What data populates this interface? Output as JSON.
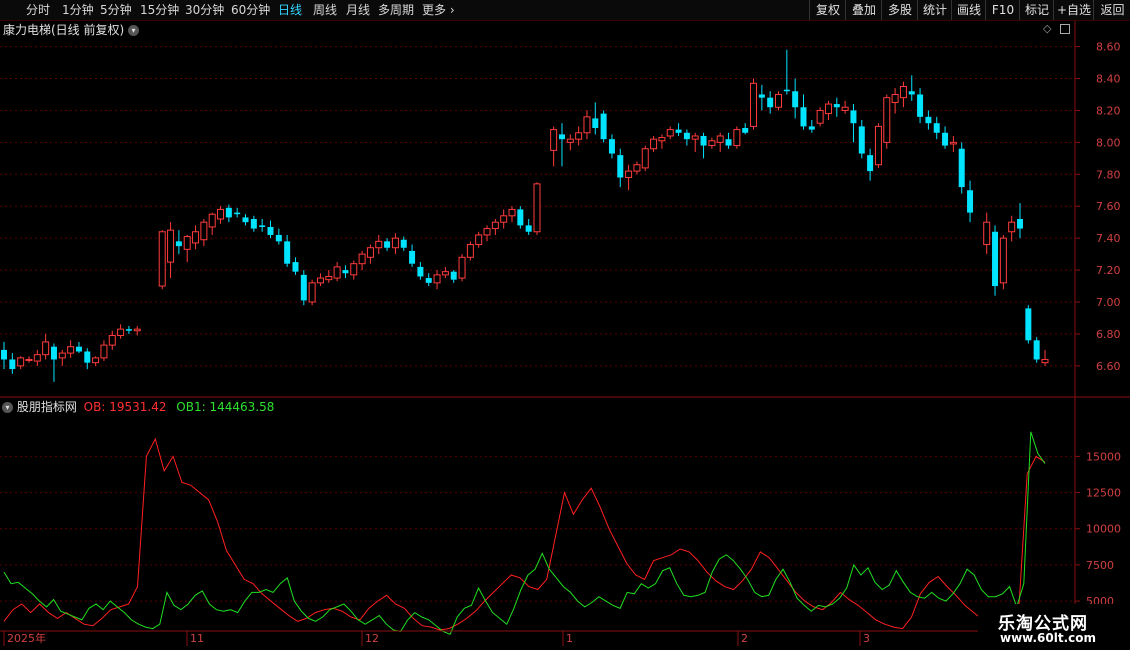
{
  "toolbar": {
    "periods": [
      "分时",
      "1分钟",
      "5分钟",
      "15分钟",
      "30分钟",
      "60分钟",
      "日线",
      "周线",
      "月线",
      "多周期",
      "更多"
    ],
    "active_period": "日线",
    "right_buttons": [
      "复权",
      "叠加",
      "多股",
      "统计",
      "画线",
      "F10",
      "标记",
      "+自选",
      "返回"
    ]
  },
  "chart": {
    "title": "康力电梯(日线 前复权)"
  },
  "indicator": {
    "name": "股朋指标网",
    "ob_label": "OB: 19531.42",
    "ob1_label": "OB1: 144463.58"
  },
  "colors": {
    "up": "#ff3c3c",
    "down": "#00e4ff",
    "ob": "#ff2020",
    "ob1": "#20e020",
    "grid": "#5a0000",
    "axis_text": "#d04040"
  },
  "watermark": {
    "line1": "乐淘公式网",
    "line2": "www.60lt.com"
  },
  "chart_data": [
    {
      "type": "candlestick",
      "title": "康力电梯(日线 前复权)",
      "y_ticks": [
        6.6,
        6.8,
        7.0,
        7.2,
        7.4,
        7.6,
        7.8,
        8.0,
        8.2,
        8.4,
        8.6
      ],
      "ylim": [
        6.43,
        8.66
      ],
      "ohlc": [
        [
          6.7,
          6.75,
          6.58,
          6.64
        ],
        [
          6.64,
          6.68,
          6.55,
          6.58
        ],
        [
          6.6,
          6.66,
          6.58,
          6.65
        ],
        [
          6.64,
          6.66,
          6.62,
          6.64
        ],
        [
          6.63,
          6.7,
          6.6,
          6.67
        ],
        [
          6.67,
          6.8,
          6.64,
          6.75
        ],
        [
          6.72,
          6.74,
          6.5,
          6.64
        ],
        [
          6.65,
          6.7,
          6.6,
          6.68
        ],
        [
          6.68,
          6.76,
          6.65,
          6.72
        ],
        [
          6.72,
          6.75,
          6.68,
          6.69
        ],
        [
          6.69,
          6.71,
          6.58,
          6.62
        ],
        [
          6.62,
          6.66,
          6.6,
          6.65
        ],
        [
          6.65,
          6.76,
          6.63,
          6.73
        ],
        [
          6.73,
          6.82,
          6.7,
          6.79
        ],
        [
          6.79,
          6.86,
          6.77,
          6.83
        ],
        [
          6.83,
          6.85,
          6.8,
          6.82
        ],
        [
          6.82,
          6.85,
          6.79,
          6.83
        ],
        [
          7.1,
          7.45,
          7.08,
          7.44
        ],
        [
          7.25,
          7.5,
          7.15,
          7.45
        ],
        [
          7.38,
          7.45,
          7.3,
          7.35
        ],
        [
          7.33,
          7.42,
          7.25,
          7.41
        ],
        [
          7.37,
          7.48,
          7.33,
          7.44
        ],
        [
          7.39,
          7.52,
          7.35,
          7.5
        ],
        [
          7.47,
          7.56,
          7.42,
          7.55
        ],
        [
          7.52,
          7.6,
          7.49,
          7.58
        ],
        [
          7.59,
          7.61,
          7.5,
          7.53
        ],
        [
          7.56,
          7.59,
          7.53,
          7.55
        ],
        [
          7.53,
          7.55,
          7.48,
          7.5
        ],
        [
          7.52,
          7.54,
          7.44,
          7.46
        ],
        [
          7.48,
          7.52,
          7.44,
          7.47
        ],
        [
          7.47,
          7.51,
          7.4,
          7.42
        ],
        [
          7.42,
          7.46,
          7.36,
          7.38
        ],
        [
          7.38,
          7.42,
          7.22,
          7.24
        ],
        [
          7.25,
          7.28,
          7.17,
          7.19
        ],
        [
          7.17,
          7.2,
          6.98,
          7.01
        ],
        [
          7.0,
          7.14,
          6.98,
          7.12
        ],
        [
          7.12,
          7.18,
          7.1,
          7.15
        ],
        [
          7.14,
          7.2,
          7.12,
          7.16
        ],
        [
          7.15,
          7.25,
          7.13,
          7.22
        ],
        [
          7.2,
          7.23,
          7.15,
          7.18
        ],
        [
          7.17,
          7.26,
          7.14,
          7.24
        ],
        [
          7.24,
          7.32,
          7.2,
          7.3
        ],
        [
          7.28,
          7.36,
          7.24,
          7.34
        ],
        [
          7.34,
          7.42,
          7.3,
          7.38
        ],
        [
          7.38,
          7.4,
          7.32,
          7.34
        ],
        [
          7.34,
          7.43,
          7.3,
          7.4
        ],
        [
          7.39,
          7.41,
          7.32,
          7.34
        ],
        [
          7.32,
          7.36,
          7.22,
          7.24
        ],
        [
          7.22,
          7.25,
          7.14,
          7.16
        ],
        [
          7.15,
          7.18,
          7.1,
          7.12
        ],
        [
          7.12,
          7.2,
          7.08,
          7.17
        ],
        [
          7.17,
          7.22,
          7.15,
          7.19
        ],
        [
          7.19,
          7.2,
          7.12,
          7.14
        ],
        [
          7.15,
          7.3,
          7.13,
          7.28
        ],
        [
          7.28,
          7.38,
          7.26,
          7.36
        ],
        [
          7.36,
          7.44,
          7.34,
          7.42
        ],
        [
          7.42,
          7.48,
          7.38,
          7.46
        ],
        [
          7.46,
          7.52,
          7.42,
          7.5
        ],
        [
          7.5,
          7.58,
          7.46,
          7.54
        ],
        [
          7.54,
          7.6,
          7.5,
          7.58
        ],
        [
          7.58,
          7.6,
          7.46,
          7.48
        ],
        [
          7.48,
          7.52,
          7.42,
          7.44
        ],
        [
          7.44,
          7.75,
          7.42,
          7.74
        ],
        [
          7.95,
          8.1,
          7.85,
          8.08
        ],
        [
          8.05,
          8.12,
          7.85,
          8.02
        ],
        [
          8.0,
          8.05,
          7.95,
          8.02
        ],
        [
          8.02,
          8.1,
          7.98,
          8.06
        ],
        [
          8.06,
          8.2,
          8.02,
          8.16
        ],
        [
          8.15,
          8.25,
          8.05,
          8.09
        ],
        [
          8.18,
          8.2,
          8.0,
          8.02
        ],
        [
          8.02,
          8.05,
          7.9,
          7.93
        ],
        [
          7.92,
          7.96,
          7.72,
          7.78
        ],
        [
          7.78,
          7.86,
          7.7,
          7.82
        ],
        [
          7.82,
          7.88,
          7.8,
          7.86
        ],
        [
          7.84,
          7.98,
          7.82,
          7.96
        ],
        [
          7.96,
          8.04,
          7.94,
          8.02
        ],
        [
          8.01,
          8.05,
          7.96,
          8.03
        ],
        [
          8.04,
          8.1,
          8.02,
          8.08
        ],
        [
          8.08,
          8.12,
          8.04,
          8.06
        ],
        [
          8.06,
          8.08,
          7.98,
          8.02
        ],
        [
          8.02,
          8.06,
          7.94,
          8.04
        ],
        [
          8.04,
          8.06,
          7.9,
          7.98
        ],
        [
          7.98,
          8.03,
          7.96,
          8.01
        ],
        [
          8.0,
          8.06,
          7.94,
          8.04
        ],
        [
          8.02,
          8.06,
          7.96,
          7.98
        ],
        [
          7.98,
          8.1,
          7.96,
          8.08
        ],
        [
          8.09,
          8.12,
          8.05,
          8.06
        ],
        [
          8.1,
          8.4,
          8.08,
          8.37
        ],
        [
          8.3,
          8.36,
          8.2,
          8.28
        ],
        [
          8.28,
          8.32,
          8.18,
          8.22
        ],
        [
          8.22,
          8.32,
          8.2,
          8.3
        ],
        [
          8.33,
          8.58,
          8.3,
          8.32
        ],
        [
          8.32,
          8.4,
          8.15,
          8.22
        ],
        [
          8.22,
          8.3,
          8.08,
          8.1
        ],
        [
          8.1,
          8.14,
          8.06,
          8.08
        ],
        [
          8.12,
          8.22,
          8.1,
          8.2
        ],
        [
          8.18,
          8.26,
          8.14,
          8.24
        ],
        [
          8.24,
          8.28,
          8.16,
          8.22
        ],
        [
          8.2,
          8.26,
          8.18,
          8.22
        ],
        [
          8.2,
          8.24,
          8.0,
          8.12
        ],
        [
          8.1,
          8.14,
          7.9,
          7.93
        ],
        [
          7.92,
          7.96,
          7.76,
          7.82
        ],
        [
          7.86,
          8.12,
          7.84,
          8.1
        ],
        [
          8.0,
          8.3,
          7.96,
          8.28
        ],
        [
          8.25,
          8.34,
          8.18,
          8.3
        ],
        [
          8.28,
          8.38,
          8.22,
          8.35
        ],
        [
          8.32,
          8.42,
          8.26,
          8.3
        ],
        [
          8.3,
          8.34,
          8.12,
          8.16
        ],
        [
          8.16,
          8.2,
          8.08,
          8.12
        ],
        [
          8.12,
          8.16,
          8.02,
          8.06
        ],
        [
          8.06,
          8.1,
          7.96,
          7.98
        ],
        [
          7.99,
          8.04,
          7.94,
          8.0
        ],
        [
          7.96,
          8.0,
          7.68,
          7.72
        ],
        [
          7.7,
          7.76,
          7.5,
          7.56
        ],
        [
          7.36,
          7.56,
          7.3,
          7.5
        ],
        [
          7.44,
          7.48,
          7.04,
          7.1
        ],
        [
          7.12,
          7.42,
          7.08,
          7.4
        ],
        [
          7.44,
          7.54,
          7.38,
          7.5
        ],
        [
          7.52,
          7.62,
          7.4,
          7.46
        ],
        [
          6.96,
          6.98,
          6.74,
          6.76
        ],
        [
          6.76,
          6.78,
          6.62,
          6.64
        ],
        [
          6.62,
          6.7,
          6.6,
          6.64
        ]
      ],
      "gaps_after": [
        16,
        62,
        113
      ]
    },
    {
      "type": "line",
      "title": "股朋指标网",
      "y_ticks": [
        5000,
        7500,
        10000,
        12500,
        15000
      ],
      "ylim": [
        3000,
        18000
      ],
      "x_ticks": [
        "2025年",
        "11",
        "12",
        "1",
        "2",
        "3"
      ],
      "series": [
        {
          "name": "OB",
          "values": [
            3600,
            4400,
            4800,
            4200,
            4800,
            4200,
            3800,
            4200,
            3800,
            3400,
            3300,
            3800,
            4400,
            4600,
            4800,
            6000,
            15000,
            16200,
            14000,
            15000,
            13200,
            13000,
            12500,
            12000,
            10500,
            8500,
            7500,
            6500,
            6200,
            5500,
            5000,
            4500,
            4000,
            3600,
            3800,
            4200,
            4400,
            4500,
            4300,
            3900,
            3700,
            4500,
            5000,
            5400,
            4800,
            4500,
            3800,
            3300,
            3200,
            3000,
            3100,
            3400,
            3800,
            4300,
            5000,
            5600,
            6200,
            6800,
            6600,
            6000,
            5800,
            6500,
            9500,
            12500,
            11000,
            12000,
            12800,
            11500,
            10000,
            8800,
            7600,
            6800,
            6500,
            7800,
            8000,
            8200,
            8600,
            8400,
            7800,
            7000,
            6400,
            6000,
            5800,
            6400,
            7200,
            8400,
            8000,
            7200,
            6400,
            5600,
            5000,
            4600,
            4400,
            4900,
            5600,
            5100,
            4700,
            4200,
            3700,
            3400,
            3200,
            3100,
            3900,
            5500,
            6300,
            6700,
            6000,
            5400,
            4700,
            4200,
            3700,
            3300,
            3200,
            3200,
            3900,
            13800,
            15000,
            14600
          ]
        },
        {
          "name": "OB1",
          "values": [
            7000,
            6200,
            6300,
            5900,
            5500,
            5000,
            4600,
            5100,
            4300,
            4100,
            3900,
            3700,
            4500,
            4800,
            4400,
            5000,
            4600,
            4200,
            3700,
            3400,
            3200,
            3100,
            3400,
            5600,
            4700,
            4400,
            4800,
            5400,
            5700,
            4800,
            4400,
            4300,
            4400,
            4200,
            5000,
            5600,
            5600,
            5800,
            5600,
            6200,
            6600,
            5000,
            4300,
            3800,
            3600,
            3900,
            4400,
            4600,
            4800,
            4300,
            3700,
            3400,
            3700,
            4000,
            3400,
            3000,
            2900,
            3700,
            4200,
            3900,
            3700,
            3300,
            2900,
            2700,
            3900,
            4500,
            4700,
            5900,
            5000,
            4200,
            3800,
            3400,
            4500,
            5800,
            6800,
            7200,
            8300,
            7200,
            6600,
            6000,
            5600,
            5000,
            4600,
            4900,
            5300,
            5000,
            4700,
            4500,
            5600,
            5500,
            6200,
            5900,
            6200,
            7100,
            7300,
            6200,
            5400,
            5300,
            5400,
            5600,
            7000,
            7900,
            8200,
            7800,
            7200,
            6500,
            5600,
            5300,
            5400,
            6500,
            7200,
            6300,
            5200,
            4700,
            4300,
            4700,
            4600,
            4800,
            5200,
            5900,
            7500,
            6800,
            7300,
            6300,
            5800,
            6100,
            7100,
            6300,
            5600,
            5300,
            5200,
            5600,
            5200,
            5000,
            5500,
            6200,
            7200,
            6800,
            5800,
            5300,
            5300,
            5500,
            6000,
            4600,
            6200,
            16700,
            15200,
            14500
          ]
        }
      ]
    }
  ]
}
